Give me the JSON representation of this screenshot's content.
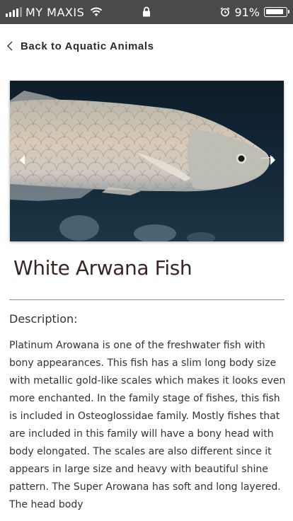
{
  "status_bar": {
    "carrier": "MY MAXIS",
    "battery": "91%",
    "battery_level": 0.91,
    "icons": [
      "signal-icon",
      "wifi-icon",
      "lock-icon",
      "alarm-icon",
      "battery-icon"
    ]
  },
  "nav": {
    "back_label": "Back to Aquatic Animals"
  },
  "carousel": {
    "image_subject": "White Arwana Fish",
    "prev_icon": "arrow-left-icon",
    "next_icon": "arrow-right-icon"
  },
  "animal": {
    "title": "White Arwana Fish",
    "description_heading": "Description:",
    "description": "Platinum Arowana is one of the freshwater fish with bony appearances. This fish has a slim long body size with metallic gold-like scales which makes it looks even more enchanted. In the family stage of fishes, this fish is included in Osteoglossidae family. Mostly fishes that are included in this family will have a bony head with body elongated. The scales are also different since it appears in large size and heavy with beautiful shine pattern. The Super Arowana has soft and long layered. The head body"
  }
}
